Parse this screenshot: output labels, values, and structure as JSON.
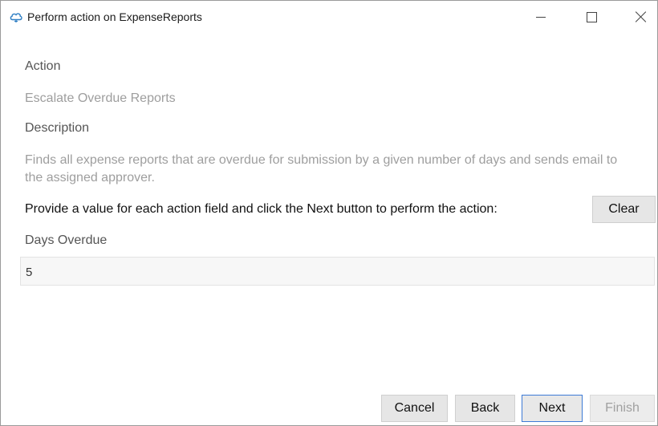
{
  "window": {
    "title": "Perform action on ExpenseReports",
    "app_icon": "cloud-icon",
    "controls": [
      "minimize-icon",
      "maximize-icon",
      "close-icon"
    ]
  },
  "action": {
    "label": "Action",
    "value": "Escalate Overdue Reports"
  },
  "description": {
    "label": "Description",
    "value": "Finds all expense reports that are overdue for submission by a given number of days and sends email to the assigned approver."
  },
  "instruction": "Provide a value for each action field and click the Next button to perform the action:",
  "clear_label": "Clear",
  "fields": [
    {
      "label": "Days Overdue",
      "value": "5"
    }
  ],
  "footer": {
    "cancel_label": "Cancel",
    "back_label": "Back",
    "next_label": "Next",
    "finish_label": "Finish"
  },
  "colors": {
    "accent_border": "#3d7bd6",
    "muted_text": "#9e9e9e",
    "button_bg": "#e6e6e6"
  }
}
